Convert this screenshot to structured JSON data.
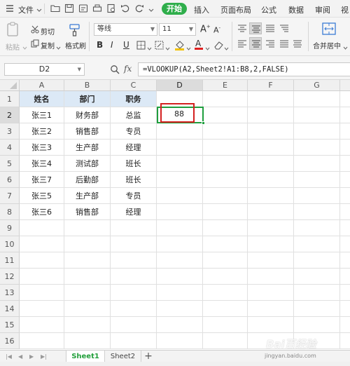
{
  "menubar": {
    "file": "文件",
    "start": "开始",
    "tabs": [
      "插入",
      "页面布局",
      "公式",
      "数据",
      "审阅",
      "视"
    ]
  },
  "ribbon": {
    "paste": "粘贴",
    "cut": "剪切",
    "copy": "复制",
    "format_painter": "格式刷",
    "font_name": "等线",
    "font_size": "11",
    "bold": "B",
    "italic": "I",
    "underline": "U",
    "merge_center": "合并居中",
    "font_color_accent": "#e02020",
    "fill_color_accent": "#f2c200"
  },
  "formula_bar": {
    "name_box": "D2",
    "fx": "fx",
    "formula": "=VLOOKUP(A2,Sheet2!A1:B8,2,FALSE)"
  },
  "sheet": {
    "columns": [
      "A",
      "B",
      "C",
      "D",
      "E",
      "F",
      "G"
    ],
    "rows": [
      "1",
      "2",
      "3",
      "4",
      "5",
      "6",
      "7",
      "8",
      "9",
      "10",
      "11",
      "12",
      "13",
      "14",
      "15",
      "16"
    ],
    "headers": [
      "姓名",
      "部门",
      "职务"
    ],
    "data": [
      [
        "张三1",
        "财务部",
        "总监"
      ],
      [
        "张三2",
        "销售部",
        "专员"
      ],
      [
        "张三3",
        "生产部",
        "经理"
      ],
      [
        "张三4",
        "测试部",
        "班长"
      ],
      [
        "张三7",
        "后勤部",
        "班长"
      ],
      [
        "张三5",
        "生产部",
        "专员"
      ],
      [
        "张三6",
        "销售部",
        "经理"
      ]
    ],
    "active_cell_value": "88",
    "highlight_color": "#d42020",
    "selection_color": "#1f9e3e"
  },
  "tabs": {
    "sheet1": "Sheet1",
    "sheet2": "Sheet2",
    "add": "+"
  },
  "watermark": {
    "main": "Bai百经验",
    "sub": "jingyan.baidu.com"
  }
}
